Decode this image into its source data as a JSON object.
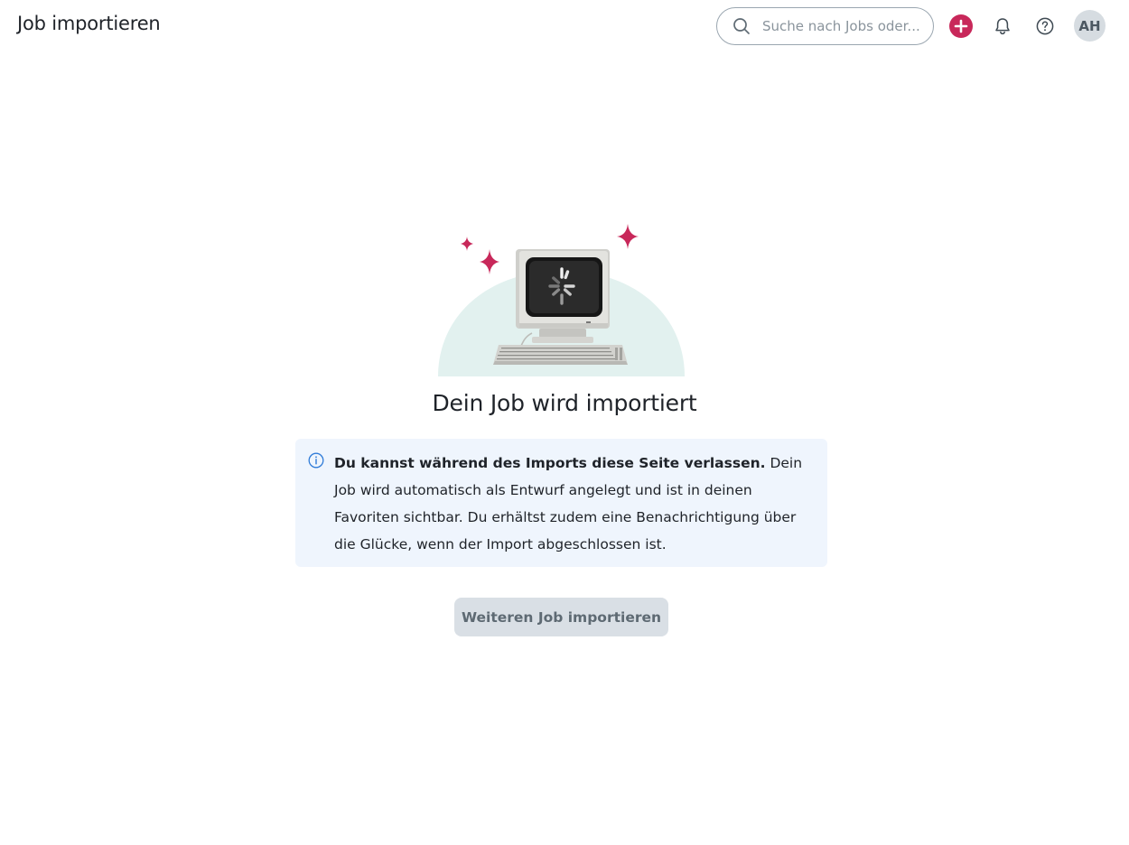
{
  "header": {
    "title": "Job importieren",
    "search": {
      "placeholder": "Suche nach Jobs oder...",
      "value": ""
    },
    "avatar_initials": "AH"
  },
  "main": {
    "heading": "Dein Job wird importiert",
    "info": {
      "bold_text": "Du kannst während des Imports diese Seite verlassen.",
      "text": " Dein Job wird automatisch als Entwurf angelegt und ist in deinen Favoriten sichtbar. Du erhältst zudem eine Benachrichtigung über die Glücke, wenn der Import abgeschlossen ist."
    },
    "secondary_button_label": "Weiteren Job importieren"
  },
  "colors": {
    "accent": "#c8285a",
    "info_background": "#eff5fd",
    "info_icon": "#2f7bd8",
    "illustration_background": "#e2f1ef",
    "button_background": "#d9dfe5"
  },
  "icons": {
    "search": "search-icon",
    "add": "plus-circle-icon",
    "notifications": "bell-icon",
    "help": "question-circle-icon",
    "info": "info-icon"
  }
}
